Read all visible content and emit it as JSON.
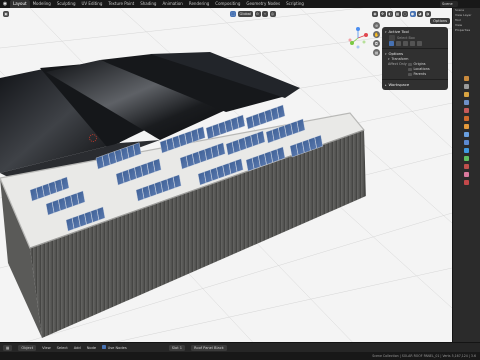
{
  "app": {
    "logo": "blender-logo"
  },
  "workspaces": [
    {
      "label": "Layout",
      "active": true
    },
    {
      "label": "Modeling"
    },
    {
      "label": "Sculpting"
    },
    {
      "label": "UV Editing"
    },
    {
      "label": "Texture Paint"
    },
    {
      "label": "Shading"
    },
    {
      "label": "Animation"
    },
    {
      "label": "Rendering"
    },
    {
      "label": "Compositing"
    },
    {
      "label": "Geometry Nodes"
    },
    {
      "label": "Scripting"
    }
  ],
  "scene_selector": {
    "label": "Scene"
  },
  "viewport_header": {
    "global_label": "Global",
    "options_label": "Options"
  },
  "npanel": {
    "active_tool": {
      "title": "Active Tool",
      "tool_name": "Select Box"
    },
    "options": {
      "title": "Options",
      "transform": {
        "title": "Transform",
        "affect_only_label": "Affect Only",
        "items": [
          "Origins",
          "Locations",
          "Parents"
        ]
      }
    },
    "workspace": {
      "title": "Workspace"
    }
  },
  "right_panel": {
    "labels": [
      "Scene",
      "View Layer",
      "Tool",
      "View",
      "Properties"
    ]
  },
  "bottombar": {
    "object_label": "Object",
    "view_label": "View",
    "select_label": "Select",
    "add_label": "Add",
    "node_label": "Node",
    "use_nodes_label": "Use Nodes",
    "slot_label": "Slot 1",
    "material_label": "Roof Panel Black"
  },
  "statusbar": {
    "text": "Scene Collection | SOLAR ROOF PANEL_01 | Verts 5,167,124 | 3.6"
  },
  "colors": {
    "accent": "#4772b3",
    "viewport_bg": "#f4f4f4",
    "ui_dark": "#303030",
    "panel_blue": "#3b5a8c"
  }
}
